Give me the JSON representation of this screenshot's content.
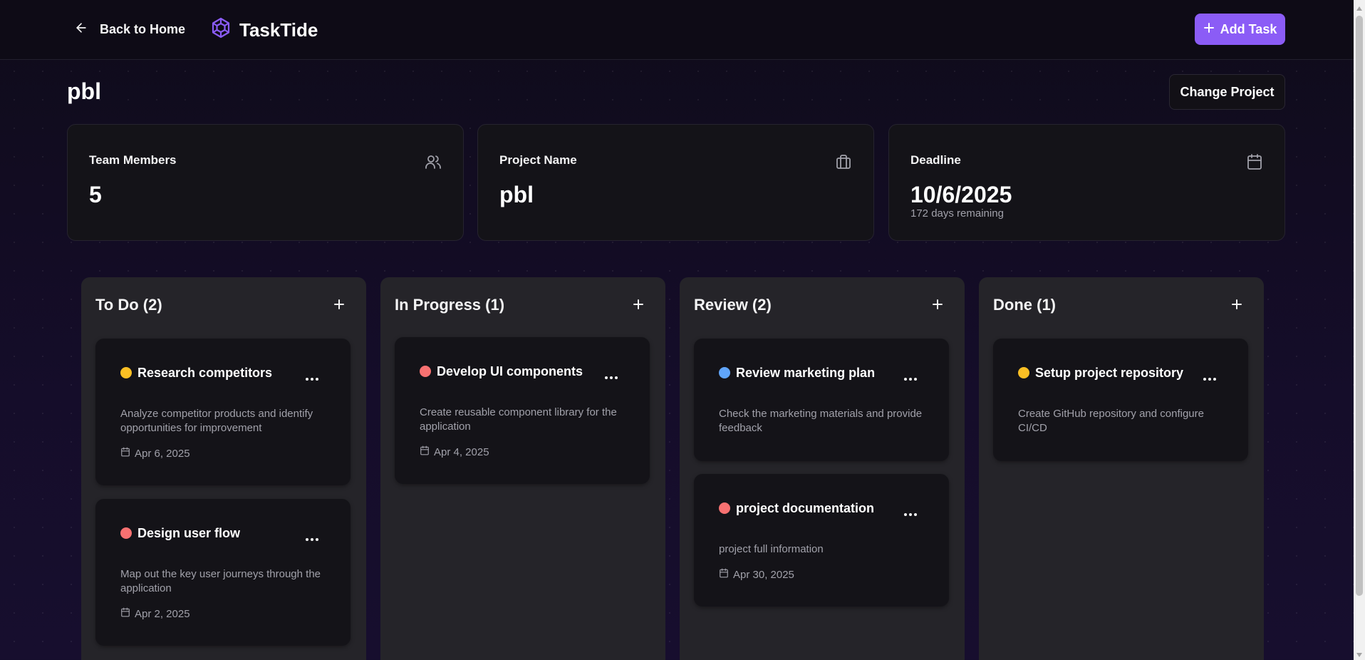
{
  "header": {
    "back_label": "Back to Home",
    "brand": "TaskTide",
    "add_task_label": "Add Task",
    "accent": "#8b5cf6"
  },
  "project": {
    "title": "pbl",
    "change_label": "Change Project"
  },
  "stats": {
    "team": {
      "label": "Team Members",
      "value": "5",
      "icon": "users-icon"
    },
    "name": {
      "label": "Project Name",
      "value": "pbl",
      "icon": "briefcase-icon"
    },
    "deadline": {
      "label": "Deadline",
      "value": "10/6/2025",
      "sub": "172 days remaining",
      "icon": "calendar-icon"
    }
  },
  "columns": [
    {
      "title": "To Do (2)",
      "cards": [
        {
          "title": "Research competitors",
          "priority_color": "#fbbf24",
          "desc": "Analyze competitor products and identify opportunities for improvement",
          "date": "Apr 6, 2025"
        },
        {
          "title": "Design user flow",
          "priority_color": "#f87171",
          "desc": "Map out the key user journeys through the application",
          "date": "Apr 2, 2025"
        }
      ]
    },
    {
      "title": "In Progress (1)",
      "cards": [
        {
          "title": "Develop UI components",
          "priority_color": "#f87171",
          "desc": "Create reusable component library for the application",
          "date": "Apr 4, 2025"
        }
      ]
    },
    {
      "title": "Review (2)",
      "cards": [
        {
          "title": "Review marketing plan",
          "priority_color": "#60a5fa",
          "desc": "Check the marketing materials and provide feedback",
          "date": ""
        },
        {
          "title": "project documentation",
          "priority_color": "#f87171",
          "desc": "project full information",
          "date": "Apr 30, 2025"
        }
      ]
    },
    {
      "title": "Done (1)",
      "cards": [
        {
          "title": "Setup project repository",
          "priority_color": "#fbbf24",
          "desc": "Create GitHub repository and configure CI/CD",
          "date": ""
        }
      ]
    }
  ]
}
